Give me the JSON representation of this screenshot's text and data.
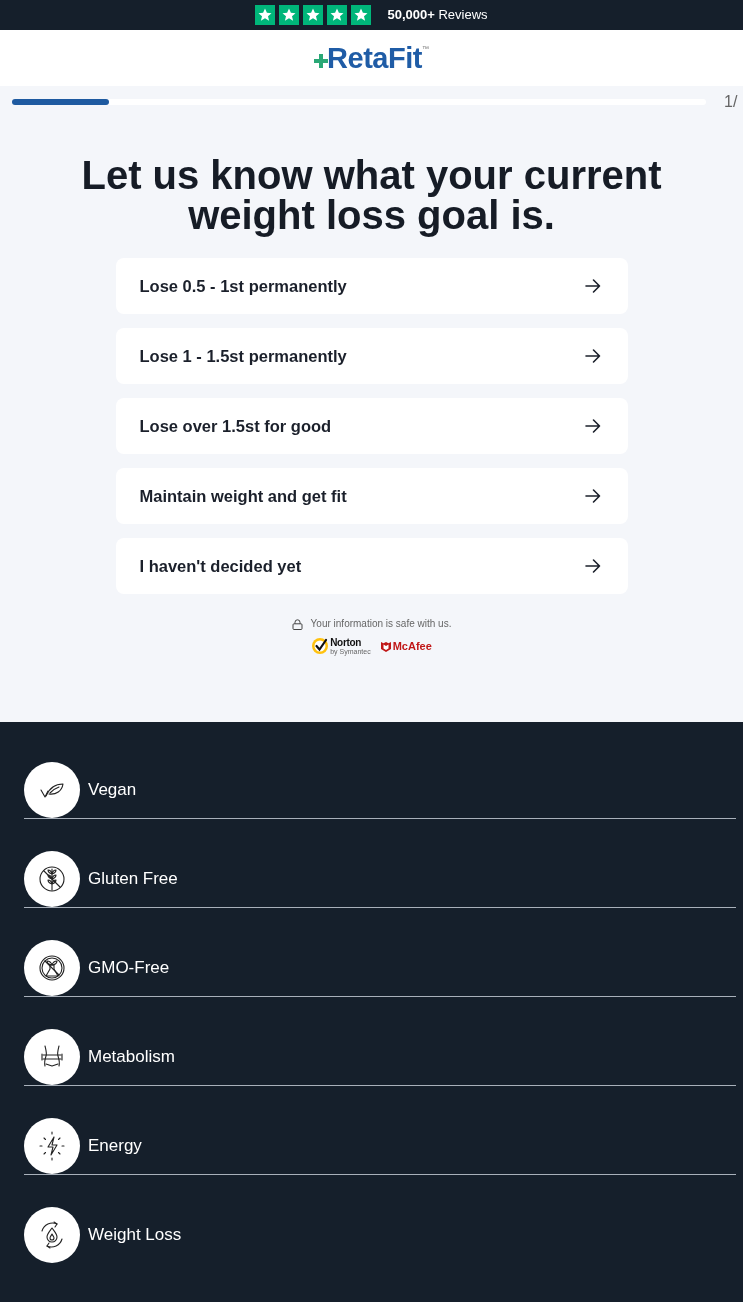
{
  "top_bar": {
    "stars": 5,
    "reviews": "**50,000+** Reviews"
  },
  "header": {
    "logo": "RetaFit",
    "trademark": "™"
  },
  "progress": {
    "level": 0.14,
    "step": "1/"
  },
  "question": "Let us know what your current weight loss goal is.",
  "options": [
    {
      "label": "Lose 0.5 - 1st permanently"
    },
    {
      "label": "Lose 1 - 1.5st permanently"
    },
    {
      "label": "Lose over 1.5st for good"
    },
    {
      "label": "Maintain weight and get fit"
    },
    {
      "label": "I haven't decided yet"
    }
  ],
  "security": {
    "note": "Your information is safe with us.",
    "badges": [
      {
        "kind": "norton",
        "name": "Norton",
        "tagline": "by Symantec"
      },
      {
        "kind": "mcafee",
        "name": "McAfee"
      }
    ]
  },
  "benefits": [
    {
      "label": "Vegan"
    },
    {
      "label": "Gluten Free"
    },
    {
      "label": "GMO-Free"
    },
    {
      "label": "Metabolism"
    },
    {
      "label": "Energy"
    },
    {
      "label": "Weight Loss"
    }
  ]
}
